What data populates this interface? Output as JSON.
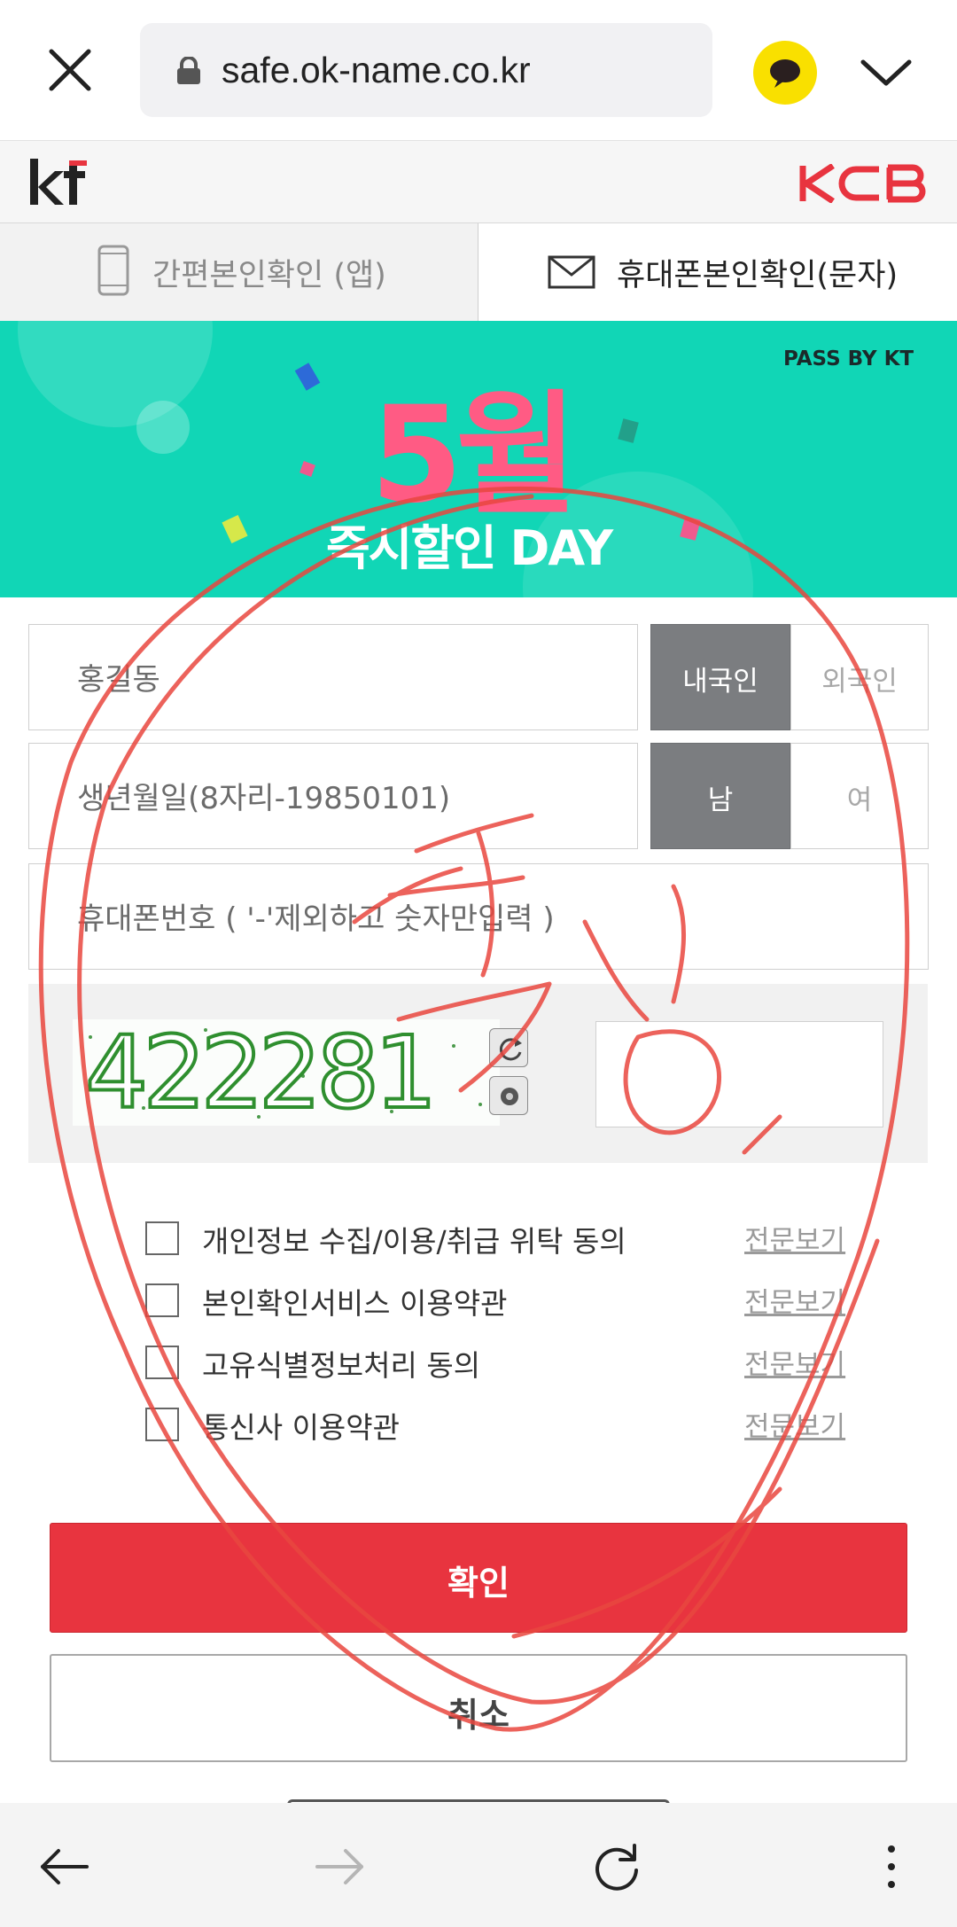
{
  "browser": {
    "url": "safe.ok-name.co.kr",
    "icons": {
      "close": "close-icon",
      "lock": "lock-icon",
      "chat": "kakao-chat-icon",
      "menu": "chevron-down-icon"
    }
  },
  "brand": {
    "left_logo": "kt",
    "right_logo": "KCB",
    "left_color": "#222222",
    "right_color": "#e8343f"
  },
  "tabs": [
    {
      "label": "간편본인확인 (앱)",
      "icon": "phone-icon",
      "active": false
    },
    {
      "label": "휴대폰본인확인(문자)",
      "icon": "mail-icon",
      "active": true
    }
  ],
  "banner": {
    "headline": "5월",
    "tagline": "즉시할인 DAY",
    "corner": "PASS BY KT",
    "bg_color": "#11d6b6"
  },
  "form": {
    "name_placeholder": "홍길동",
    "nationality": {
      "selected": "내국인",
      "other": "외국인"
    },
    "birth_placeholder": "생년월일(8자리-19850101)",
    "gender": {
      "selected": "남",
      "other": "여"
    },
    "phone_placeholder": "휴대폰번호 ( '-'제외하고 숫자만입력 )",
    "captcha_code": "422281",
    "captcha_refresh_icon": "refresh-icon",
    "captcha_audio_icon": "speaker-icon"
  },
  "agreements": [
    {
      "label": "개인정보 수집/이용/취급 위탁 동의",
      "link": "전문보기"
    },
    {
      "label": "본인확인서비스 이용약관",
      "link": "전문보기"
    },
    {
      "label": "고유식별정보처리 동의",
      "link": "전문보기"
    },
    {
      "label": "통신사 이용약관",
      "link": "전문보기"
    }
  ],
  "buttons": {
    "confirm": "확인",
    "cancel": "취소",
    "confirm_color": "#e8343f"
  },
  "annotation": {
    "handwritten_text": "작성",
    "color": "#e9473f"
  },
  "bottom_nav": {
    "back": "back-arrow-icon",
    "forward": "forward-arrow-icon",
    "reload": "reload-icon",
    "more": "more-vertical-icon"
  }
}
